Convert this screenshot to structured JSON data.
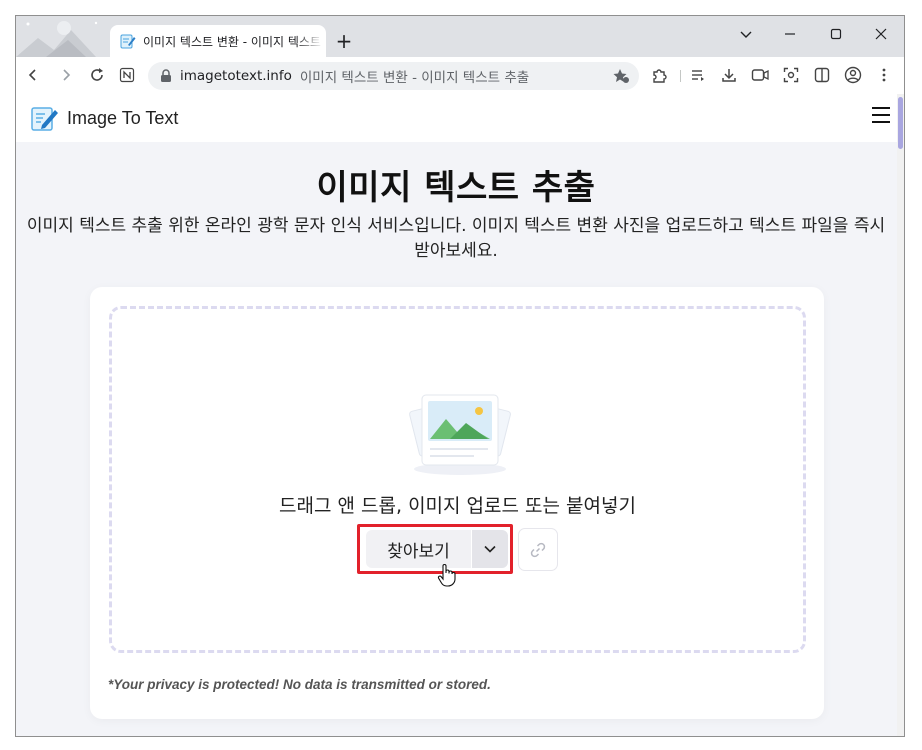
{
  "browser": {
    "tab_title": "이미지 텍스트 변환 - 이미지 텍스트 추출",
    "new_tab_symbol": "+",
    "url_host": "imagetotext.info",
    "url_page_title": "이미지 텍스트 변환 - 이미지 텍스트 추출",
    "icons": [
      "back-icon",
      "forward-icon",
      "reload-icon",
      "notion-icon",
      "lock-icon",
      "bookmark-star-icon",
      "extensions-icon",
      "reading-list-icon",
      "download-icon",
      "video-icon",
      "screenshot-icon",
      "split-view-icon",
      "profile-icon",
      "menu-kebab-icon"
    ]
  },
  "site": {
    "name": "Image To Text"
  },
  "main": {
    "title": "이미지 텍스트 추출",
    "description": "이미지 텍스트 추출 위한 온라인 광학 문자 인식 서비스입니다. 이미지 텍스트 변환 사진을 업로드하고 텍스트 파일을 즉시 받아보세요.",
    "drop_text": "드래그 앤 드롭, 이미지 업로드 또는 붙여넣기",
    "browse_label": "찾아보기",
    "privacy_note": "*Your privacy is protected! No data is transmitted or stored."
  },
  "colors": {
    "highlight": "#e2212b",
    "accent": "#a9a6e0",
    "page_bg": "#f3f4f8"
  }
}
